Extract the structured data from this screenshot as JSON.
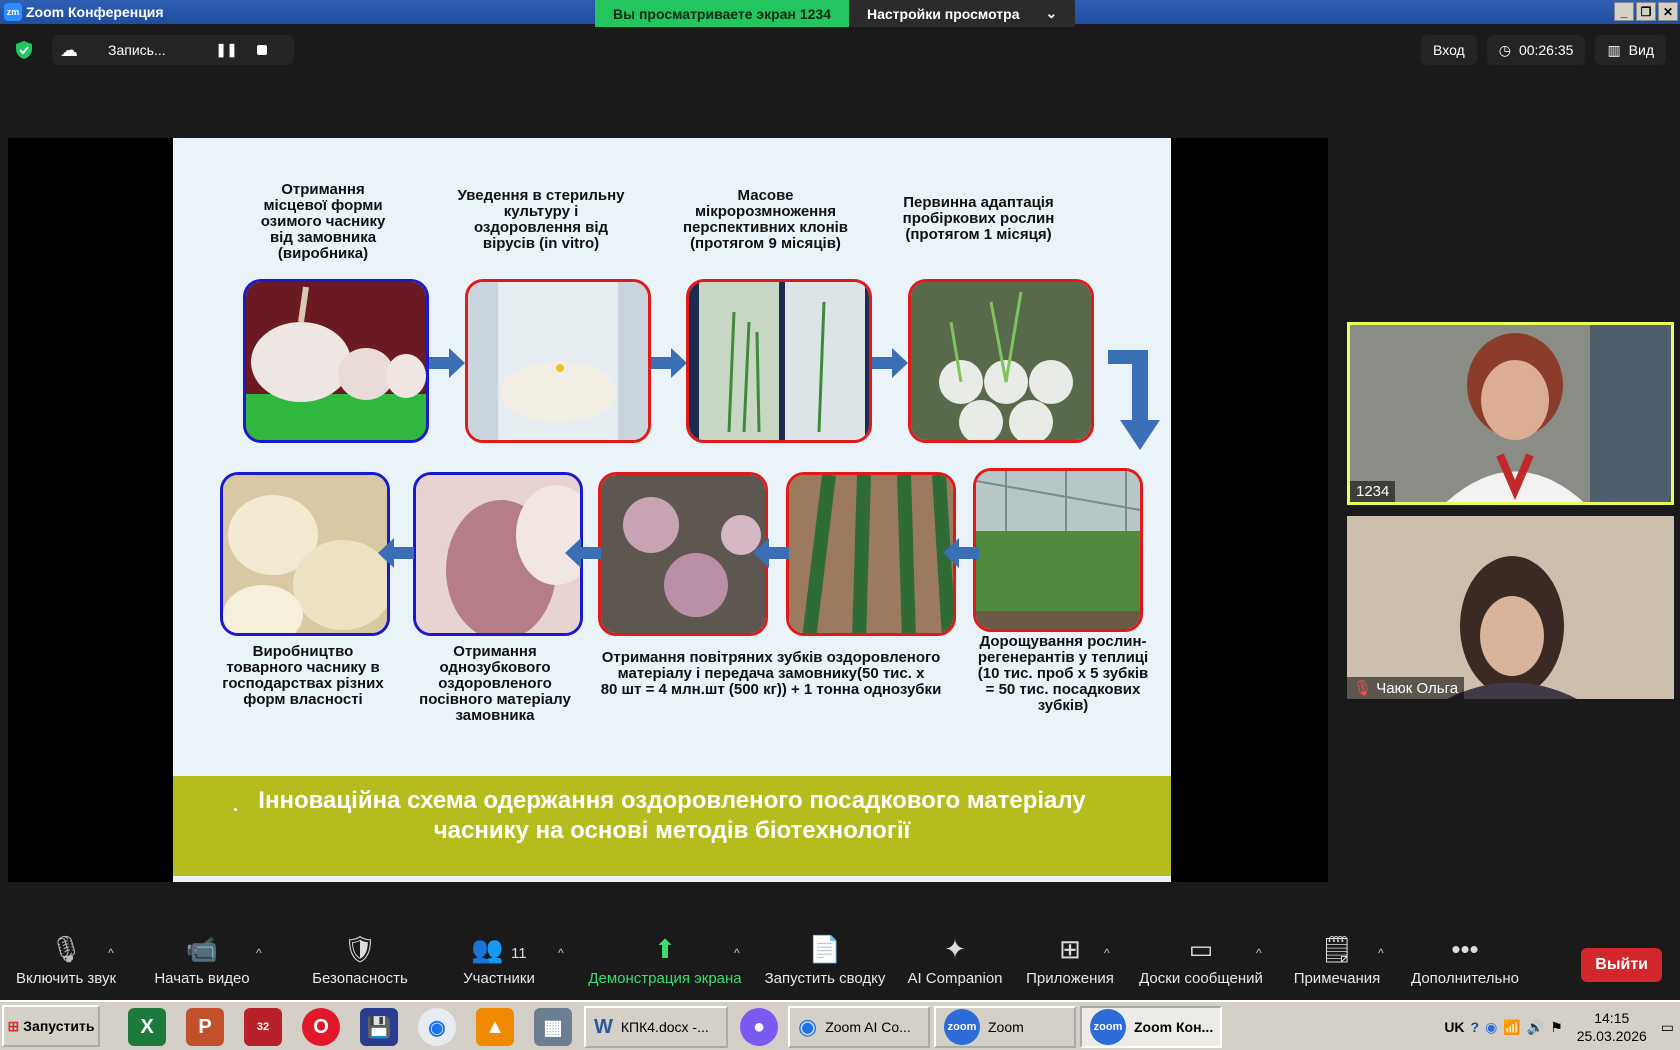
{
  "window": {
    "title": "Zoom Конференция",
    "logo": "zm"
  },
  "share_banner": {
    "status": "Вы просматриваете экран 1234",
    "view_settings": "Настройки просмотра"
  },
  "recording": {
    "label": "Запись..."
  },
  "top_right": {
    "enter": "Вход",
    "timer": "00:26:35",
    "view": "Вид"
  },
  "slide": {
    "steps": [
      "Отримання\nмісцевої форми\nозимого часнику\nвід замовника\n(виробника)",
      "Уведення в стерильну\nкультуру і\nоздоровлення від\nвірусів (in vitro)",
      "Масове\nмікророзмноження\nперспективних клонів\n(протягом 9 місяців)",
      "Первинна адаптація\nпробіркових рослин\n(протягом 1 місяця)",
      "Виробництво\nтоварного часнику в\nгосподарствах різних\nформ власності",
      "Отримання\nоднозубкового\nоздоровленого\nпосівного матеріалу\nзамовника",
      "Отримання повітряних зубків оздоровленого\nматеріалу і передача замовнику(50 тис. х\n80 шт = 4 млн.шт (500 кг)) + 1 тонна однозубки",
      "Дорощування рослин-\nрегенерантів у теплиці\n(10 тис. проб х 5 зубків\n= 50 тис. посадкових\nзубків)"
    ],
    "banner_bullet": ".",
    "banner": "Інноваційна схема одержання оздоровленого посадкового матеріалу\nчаснику на основі методів біотехнології"
  },
  "participants_video": [
    {
      "name": "1234"
    },
    {
      "name": "Чаюк Ольга"
    }
  ],
  "toolbar": {
    "unmute": "Включить звук",
    "start_video": "Начать видео",
    "security": "Безопасность",
    "participants": "Участники",
    "participants_count": "11",
    "share_screen": "Демонстрация экрана",
    "summary": "Запустить сводку",
    "ai_companion": "AI Companion",
    "apps": "Приложения",
    "whiteboards": "Доски сообщений",
    "notes": "Примечания",
    "more": "Дополнительно",
    "leave": "Выйти"
  },
  "taskbar": {
    "start": "Запустить",
    "badge": "32",
    "windows": [
      "КПК4.docx -...",
      "Zoom AI Co...",
      "Zoom",
      "Zoom Кон..."
    ],
    "lang": "UK",
    "time": "14:15",
    "date": "25.03.2026"
  },
  "colors": {
    "share_green": "#22c55e",
    "banner_olive": "#b5bd1e",
    "leave_red": "#d2272d",
    "active_speaker": "#eaff5b"
  }
}
